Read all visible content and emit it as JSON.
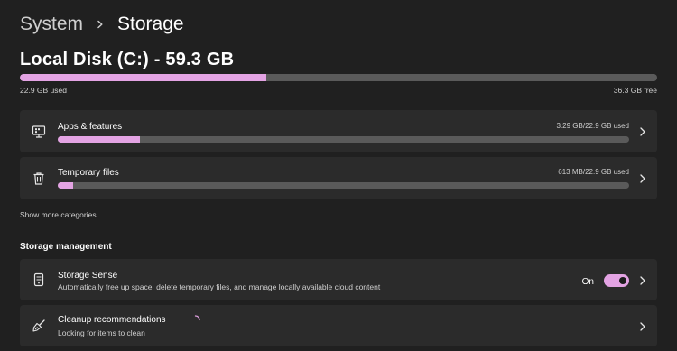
{
  "breadcrumb": {
    "parent": "System",
    "current": "Storage"
  },
  "disk": {
    "title": "Local Disk (C:) - 59.3 GB",
    "used_label": "22.9 GB used",
    "free_label": "36.3 GB free",
    "used_fraction": 0.386
  },
  "categories": [
    {
      "icon": "apps-features-icon",
      "title": "Apps & features",
      "size": "3.29 GB/22.9 GB used",
      "fraction": 0.144
    },
    {
      "icon": "trash-icon",
      "title": "Temporary files",
      "size": "613 MB/22.9 GB used",
      "fraction": 0.027
    }
  ],
  "show_more": "Show more categories",
  "storage_management": {
    "heading": "Storage management",
    "storage_sense": {
      "title": "Storage Sense",
      "subtitle": "Automatically free up space, delete temporary files, and manage locally available cloud content",
      "toggle_label": "On",
      "toggle_on": true
    },
    "cleanup": {
      "title": "Cleanup recommendations",
      "subtitle": "Looking for items to clean"
    }
  },
  "colors": {
    "accent": "#e3a3e3",
    "background": "#202020",
    "card": "#2b2b2b",
    "track": "#5a5a5a"
  }
}
